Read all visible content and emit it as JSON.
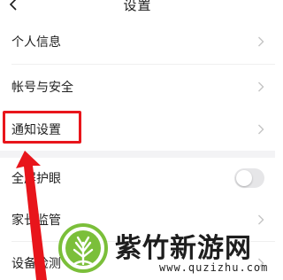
{
  "header": {
    "title": "设置",
    "back_icon": "chevron-left-icon"
  },
  "settings": {
    "group1": [
      {
        "label": "个人信息",
        "accessory": "chevron-right-icon"
      },
      {
        "label": "帐号与安全",
        "accessory": "chevron-right-icon"
      },
      {
        "label": "通知设置",
        "accessory": "chevron-right-icon"
      }
    ],
    "group2": [
      {
        "label": "全屏护眼",
        "accessory": "toggle",
        "toggle_on": false
      },
      {
        "label": "家长监管",
        "accessory": "chevron-right-icon"
      },
      {
        "label": "设备检测",
        "accessory": "chevron-right-icon"
      }
    ]
  },
  "annotation": {
    "highlight_color": "#e8151b",
    "highlighted_item": "通知设置"
  },
  "watermark": {
    "site_name": "紫竹新游网",
    "url": "www.quzizhu.com",
    "logo_color": "#7bbf3a"
  },
  "colors": {
    "background": "#ffffff",
    "section_gap": "#f3f3f5",
    "text": "#1f1f1f",
    "chevron": "#c4c4c4",
    "toggle_off": "#e6e6e8"
  }
}
